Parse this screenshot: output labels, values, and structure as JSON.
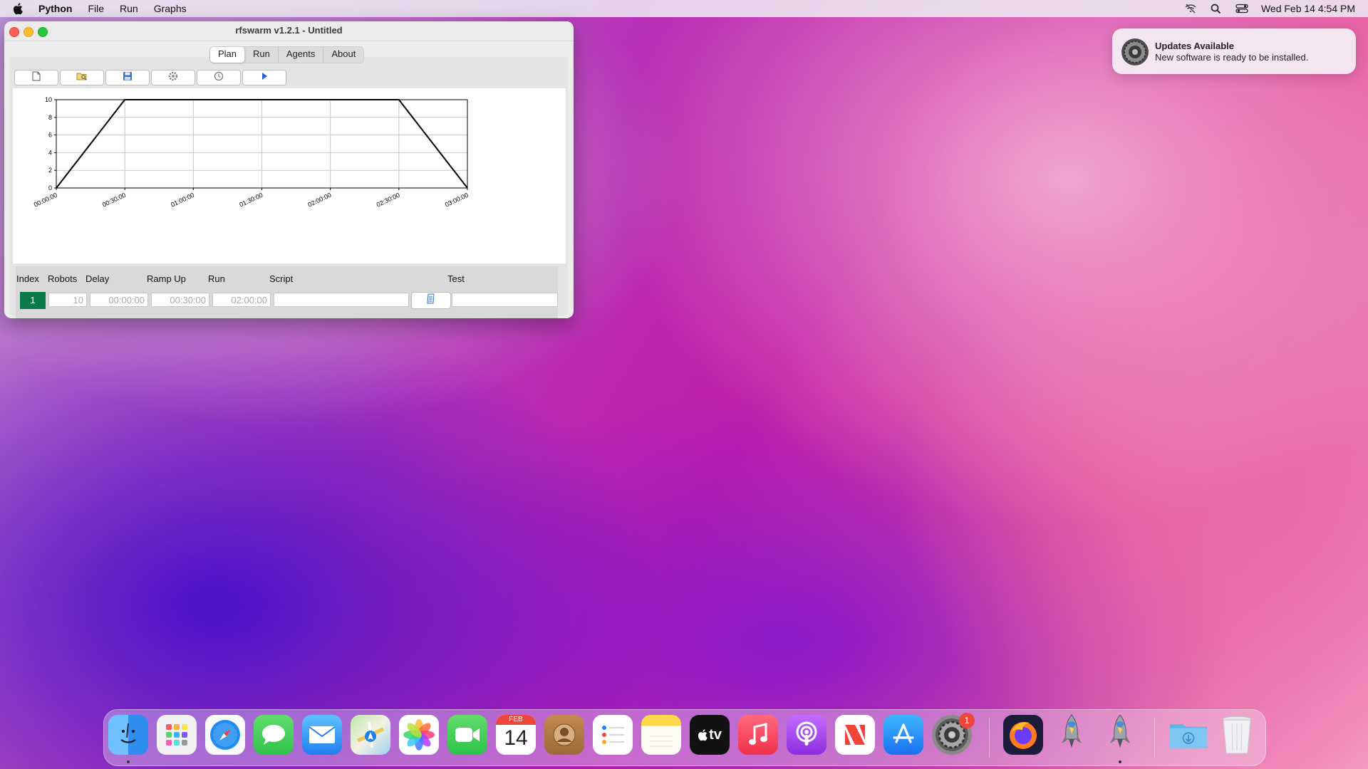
{
  "menubar": {
    "app": "Python",
    "items": [
      "File",
      "Run",
      "Graphs"
    ],
    "datetime": "Wed Feb 14  4:54 PM"
  },
  "notification": {
    "title": "Updates Available",
    "body": "New software is ready to be installed."
  },
  "window": {
    "title": "rfswarm v1.2.1 - Untitled",
    "tabs": [
      "Plan",
      "Run",
      "Agents",
      "About"
    ],
    "active_tab": "Plan",
    "toolbar_icons": [
      "new-file-icon",
      "open-folder-icon",
      "save-icon",
      "settings-gear-icon",
      "clock-icon",
      "play-icon"
    ]
  },
  "grid": {
    "headers": {
      "index": "Index",
      "robots": "Robots",
      "delay": "Delay",
      "rampup": "Ramp Up",
      "run": "Run",
      "script": "Script",
      "test": "Test"
    },
    "row": {
      "index": "1",
      "robots": "10",
      "delay": "00:00:00",
      "rampup": "00:30:00",
      "run": "02:00:00",
      "script": "",
      "test": ""
    }
  },
  "chart_data": {
    "type": "line",
    "x": [
      "00:00:00",
      "00:30:00",
      "01:00:00",
      "01:30:00",
      "02:00:00",
      "02:30:00",
      "03:00:00"
    ],
    "series": [
      {
        "x": [
          "00:00:00",
          "00:30:00",
          "02:30:00",
          "03:00:00"
        ],
        "values": [
          0,
          10,
          10,
          0
        ]
      }
    ],
    "yticks": [
      0,
      2,
      4,
      6,
      8,
      10
    ],
    "ylim": [
      0,
      10
    ],
    "grid": true,
    "title": "",
    "xlabel": "",
    "ylabel": ""
  },
  "dock": {
    "apps": [
      "finder-icon",
      "launchpad-icon",
      "safari-icon",
      "messages-icon",
      "mail-icon",
      "maps-icon",
      "photos-icon",
      "facetime-icon",
      "calendar-icon",
      "contacts-icon",
      "reminders-icon",
      "notes-icon",
      "apple-tv-icon",
      "music-icon",
      "podcasts-icon",
      "news-icon",
      "app-store-icon",
      "system-preferences-icon",
      "firefox-icon",
      "rfswarm-rocket-icon",
      "rfswarm-rocket-icon",
      "downloads-folder-icon",
      "trash-icon"
    ],
    "calendar_month": "FEB",
    "calendar_day": "14",
    "tv_label": "tv",
    "settings_badge": "1"
  }
}
